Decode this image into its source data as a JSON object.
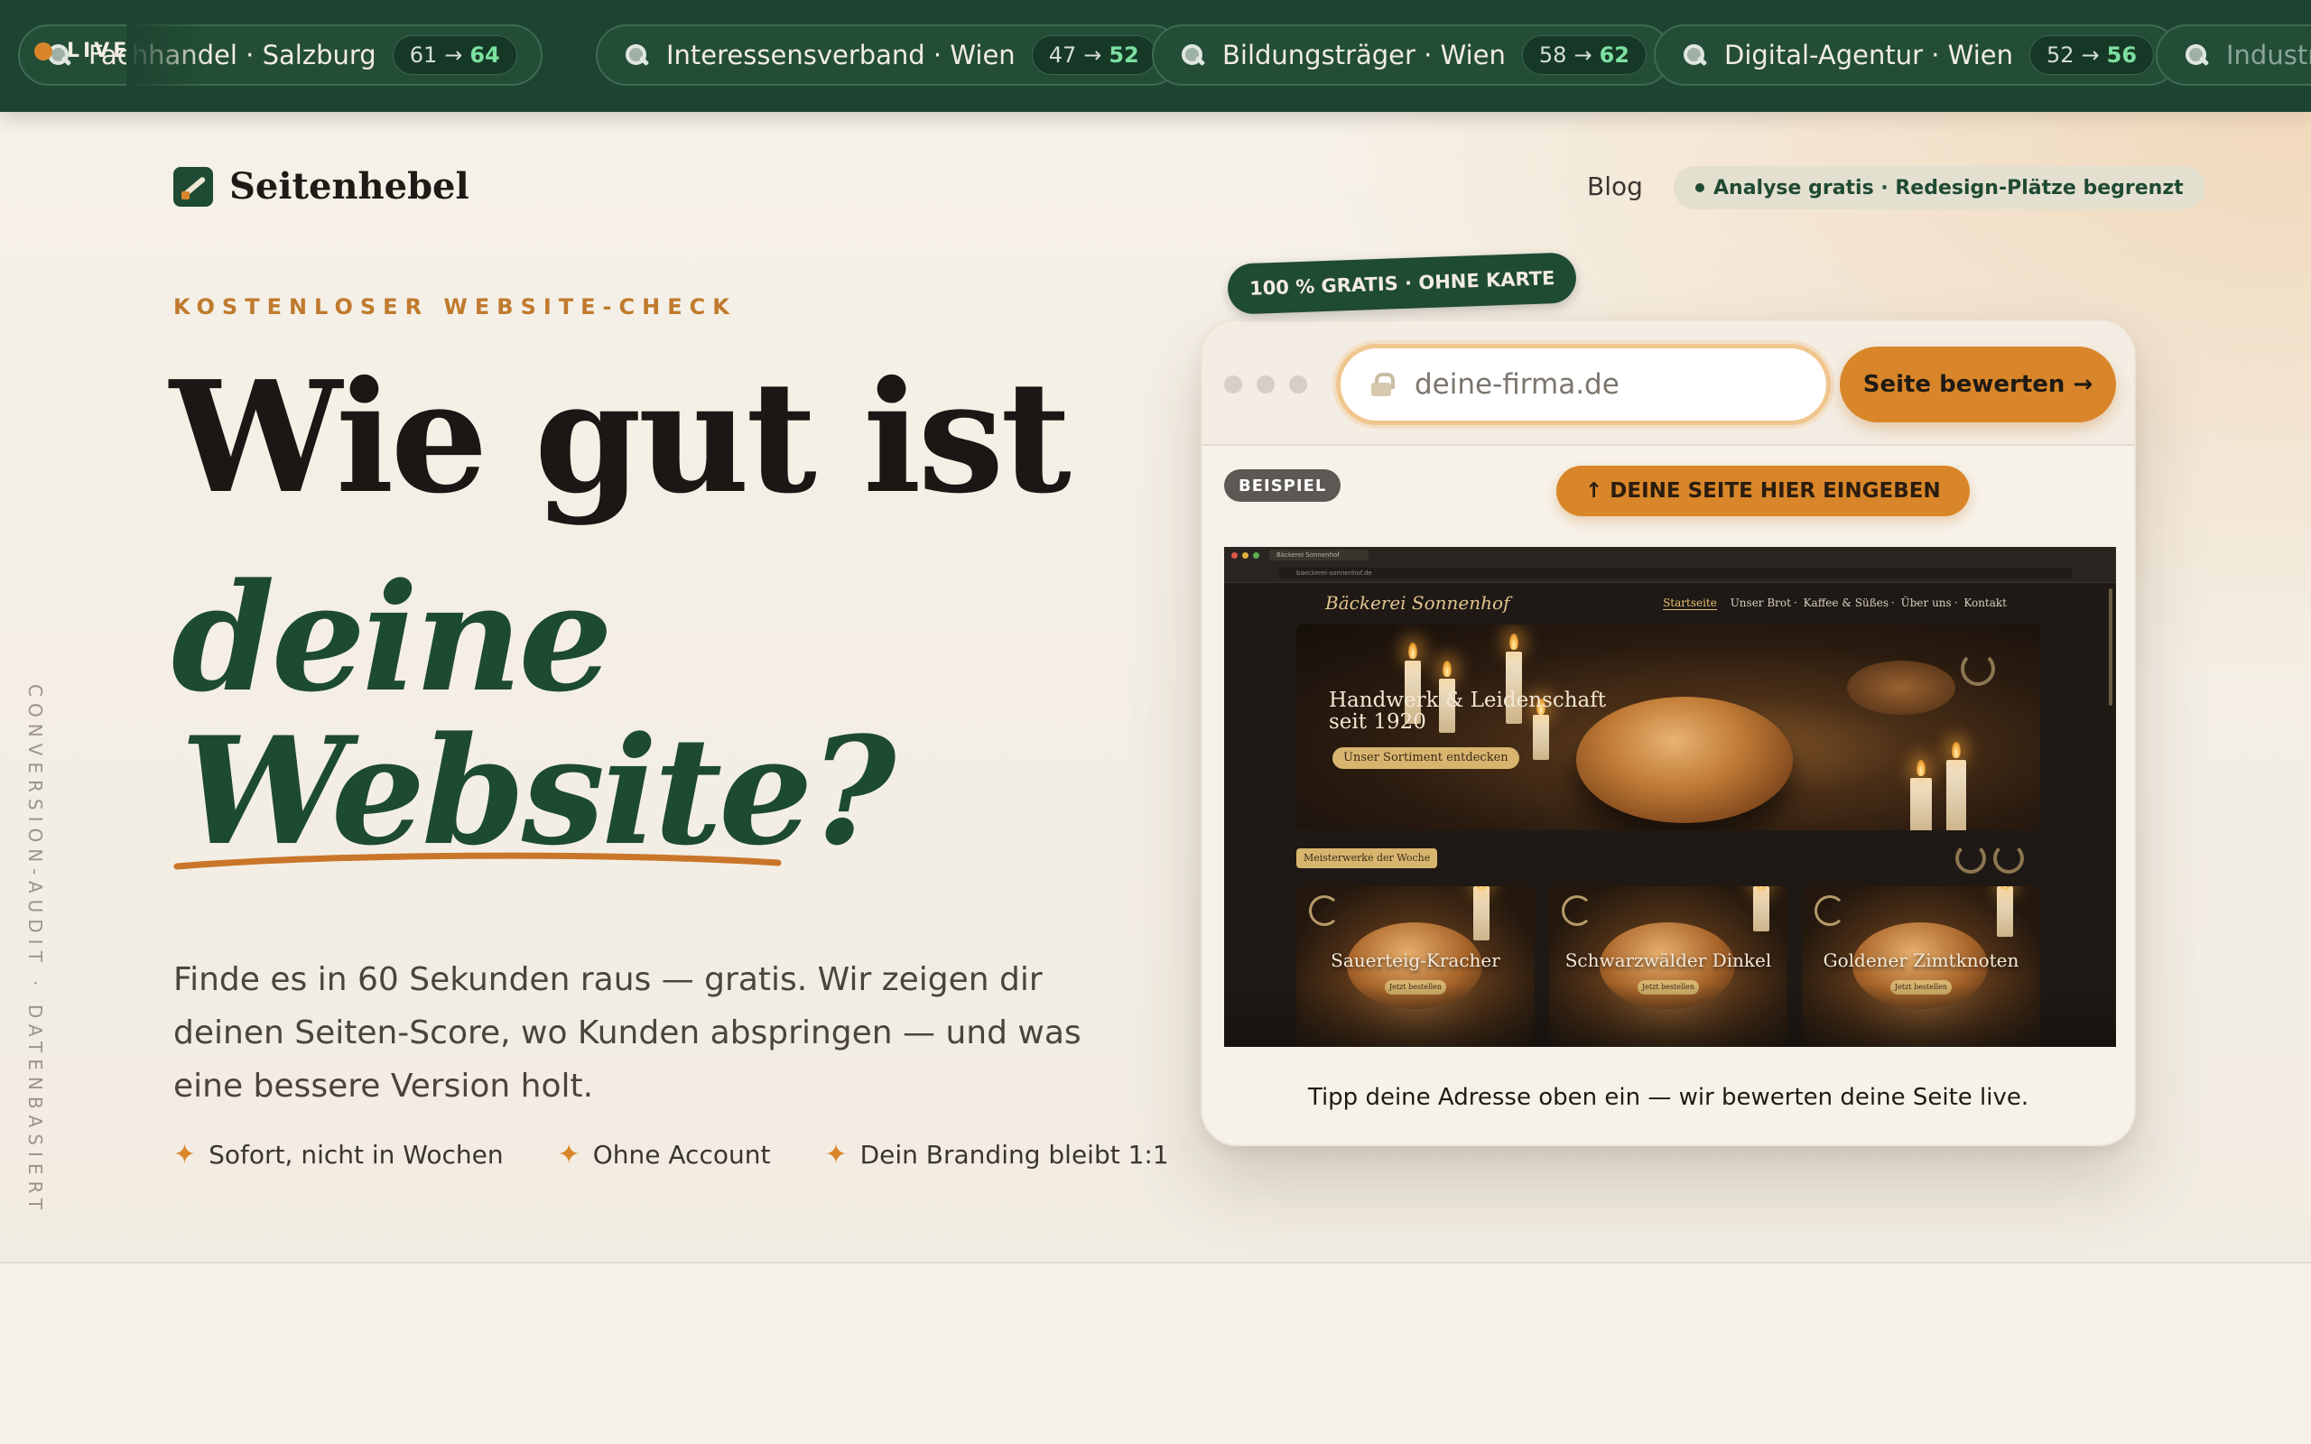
{
  "ticker": {
    "live_label": "LIVE",
    "items": [
      {
        "name": "Fachhandel · Salzburg",
        "from": "61",
        "to": "64"
      },
      {
        "name": "Interessensverband · Wien",
        "from": "47",
        "to": "52"
      },
      {
        "name": "Bildungsträger · Wien",
        "from": "58",
        "to": "62"
      },
      {
        "name": "Digital-Agentur · Wien",
        "from": "52",
        "to": "56"
      },
      {
        "name": "Industrie",
        "from": "",
        "to": ""
      }
    ]
  },
  "nav": {
    "brand": "Seitenhebel",
    "blog": "Blog",
    "badge": "Analyse gratis · Redesign-Plätze begrenzt"
  },
  "side_text": "CONVERSION-AUDIT · DATENBASIERT",
  "hero": {
    "eyebrow": "KOSTENLOSER WEBSITE-CHECK",
    "headline_1": "Wie gut ist",
    "headline_2": "deine",
    "headline_3": "Website?",
    "subtitle": "Finde es in 60 Sekunden raus — gratis. Wir zeigen dir deinen Seiten-Score, wo Kunden abspringen — und was eine bessere Version holt.",
    "bullets": [
      "Sofort, nicht in Wochen",
      "Ohne Account",
      "Dein Branding bleibt 1:1"
    ]
  },
  "analyzer": {
    "badge": "100 % GRATIS · OHNE KARTE",
    "url_placeholder": "deine-firma.de",
    "submit_label": "Seite bewerten →",
    "example_label": "BEISPIEL",
    "hint": "↑ DEINE SEITE HIER EINGEBEN",
    "caption": "Tipp deine Adresse oben ein — wir bewerten deine Seite live."
  },
  "preview": {
    "tab_title": "Bäckerei Sonnenhof",
    "address": "baeckerei-sonnenhof.de",
    "brand": "Bäckerei Sonnenhof",
    "nav": [
      "Startseite",
      "Unser Brot",
      "Kaffee & Süßes",
      "Über uns",
      "Kontakt"
    ],
    "hero_title_1": "Handwerk & Leidenschaft",
    "hero_title_2": "seit 1920",
    "hero_button": "Unser Sortiment entdecken",
    "week_label": "Meisterwerke der Woche",
    "products": [
      {
        "title": "Sauerteig-Kracher",
        "button": "Jetzt bestellen"
      },
      {
        "title": "Schwarzwälder Dinkel",
        "button": "Jetzt bestellen"
      },
      {
        "title": "Goldener Zimtknoten",
        "button": "Jetzt bestellen"
      }
    ]
  },
  "colors": {
    "brand_green": "#1d4430",
    "accent_orange": "#d9862a",
    "score_green": "#7ce0a1",
    "background": "#f6f1e8"
  }
}
